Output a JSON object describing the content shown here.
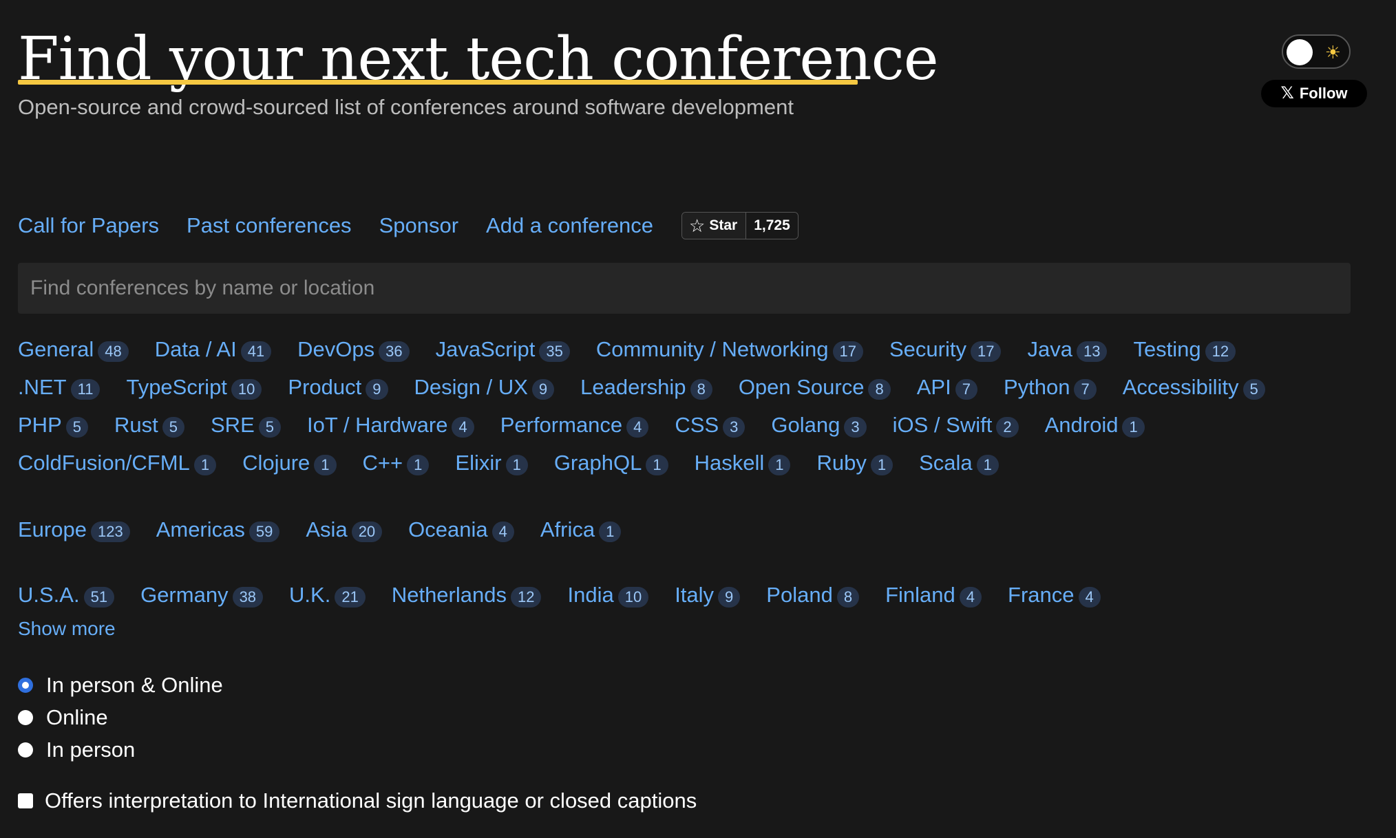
{
  "header": {
    "title": "Find your next tech conference",
    "subtitle": "Open-source and crowd-sourced list of conferences around software development",
    "follow_label": "Follow",
    "accent_color": "#f5c842"
  },
  "nav": {
    "links": [
      "Call for Papers",
      "Past conferences",
      "Sponsor",
      "Add a conference"
    ],
    "star_label": "Star",
    "star_count": "1,725"
  },
  "search": {
    "placeholder": "Find conferences by name or location"
  },
  "topics": [
    {
      "label": "General",
      "count": "48"
    },
    {
      "label": "Data / AI",
      "count": "41"
    },
    {
      "label": "DevOps",
      "count": "36"
    },
    {
      "label": "JavaScript",
      "count": "35"
    },
    {
      "label": "Community / Networking",
      "count": "17"
    },
    {
      "label": "Security",
      "count": "17"
    },
    {
      "label": "Java",
      "count": "13"
    },
    {
      "label": "Testing",
      "count": "12"
    },
    {
      "label": ".NET",
      "count": "11"
    },
    {
      "label": "TypeScript",
      "count": "10"
    },
    {
      "label": "Product",
      "count": "9"
    },
    {
      "label": "Design / UX",
      "count": "9"
    },
    {
      "label": "Leadership",
      "count": "8"
    },
    {
      "label": "Open Source",
      "count": "8"
    },
    {
      "label": "API",
      "count": "7"
    },
    {
      "label": "Python",
      "count": "7"
    },
    {
      "label": "Accessibility",
      "count": "5"
    },
    {
      "label": "PHP",
      "count": "5"
    },
    {
      "label": "Rust",
      "count": "5"
    },
    {
      "label": "SRE",
      "count": "5"
    },
    {
      "label": "IoT / Hardware",
      "count": "4"
    },
    {
      "label": "Performance",
      "count": "4"
    },
    {
      "label": "CSS",
      "count": "3"
    },
    {
      "label": "Golang",
      "count": "3"
    },
    {
      "label": "iOS / Swift",
      "count": "2"
    },
    {
      "label": "Android",
      "count": "1"
    },
    {
      "label": "ColdFusion/CFML",
      "count": "1"
    },
    {
      "label": "Clojure",
      "count": "1"
    },
    {
      "label": "C++",
      "count": "1"
    },
    {
      "label": "Elixir",
      "count": "1"
    },
    {
      "label": "GraphQL",
      "count": "1"
    },
    {
      "label": "Haskell",
      "count": "1"
    },
    {
      "label": "Ruby",
      "count": "1"
    },
    {
      "label": "Scala",
      "count": "1"
    }
  ],
  "continents": [
    {
      "label": "Europe",
      "count": "123"
    },
    {
      "label": "Americas",
      "count": "59"
    },
    {
      "label": "Asia",
      "count": "20"
    },
    {
      "label": "Oceania",
      "count": "4"
    },
    {
      "label": "Africa",
      "count": "1"
    }
  ],
  "countries": [
    {
      "label": "U.S.A.",
      "count": "51"
    },
    {
      "label": "Germany",
      "count": "38"
    },
    {
      "label": "U.K.",
      "count": "21"
    },
    {
      "label": "Netherlands",
      "count": "12"
    },
    {
      "label": "India",
      "count": "10"
    },
    {
      "label": "Italy",
      "count": "9"
    },
    {
      "label": "Poland",
      "count": "8"
    },
    {
      "label": "Finland",
      "count": "4"
    },
    {
      "label": "France",
      "count": "4"
    }
  ],
  "show_more_label": "Show more",
  "attendance_options": [
    {
      "label": "In person & Online",
      "checked": true
    },
    {
      "label": "Online",
      "checked": false
    },
    {
      "label": "In person",
      "checked": false
    }
  ],
  "accessibility_option": {
    "label": "Offers interpretation to International sign language or closed captions",
    "checked": false
  },
  "colors": {
    "background": "#181818",
    "link": "#67aef8",
    "badge_bg": "#263349"
  }
}
